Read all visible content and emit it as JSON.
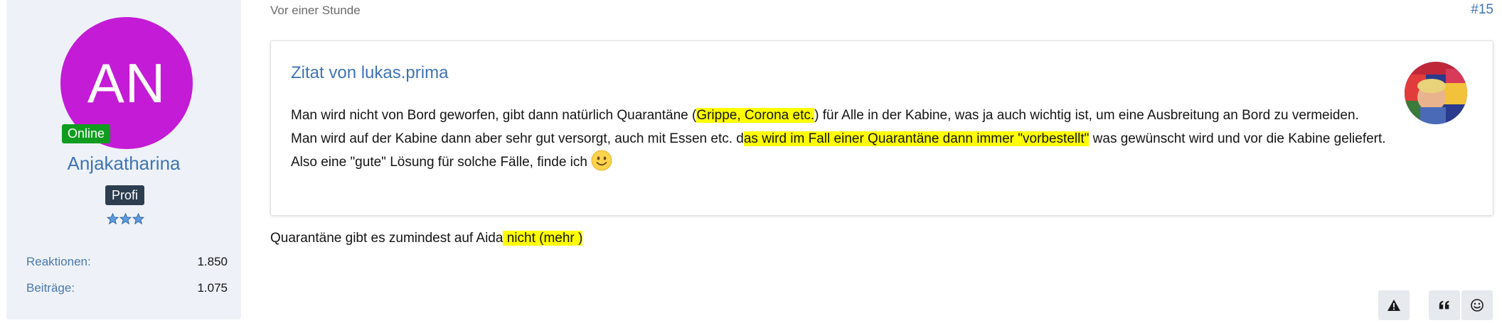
{
  "user": {
    "initials": "AN",
    "avatar_color": "#c41bd6",
    "online_label": "Online",
    "name": "Anjakatharina",
    "role": "Profi",
    "stars": 3,
    "stats": [
      {
        "label": "Reaktionen:",
        "value": "1.850"
      },
      {
        "label": "Beiträge:",
        "value": "1.075"
      }
    ]
  },
  "post": {
    "date": "Vor einer Stunde",
    "number": "#15",
    "body_before": "Quarantäne gibt es zumindest auf Aida",
    "body_highlight": " nicht (mehr )"
  },
  "quote": {
    "title": "Zitat von lukas.prima",
    "line1_a": "Man wird nicht von Bord geworfen, gibt dann natürlich Quarantäne (",
    "line1_hl": "Grippe, Corona etc.",
    "line1_b": ") für Alle in der Kabine, was ja auch wichtig ist, um eine Ausbreitung an Bord zu vermeiden.",
    "line2_a": "Man wird auf der Kabine dann aber sehr gut versorgt, auch mit Essen etc. d",
    "line2_hl": "as wird im Fall einer Quarantäne dann immer \"vorbestellt\"",
    "line2_b": " was gewünscht wird und vor die Kabine geliefert.",
    "line3": "Also eine \"gute\" Lösung für solche Fälle, finde ich"
  },
  "actions": {
    "report_icon": "warning-icon",
    "quote_icon": "quote-icon",
    "react_icon": "smiley-icon"
  },
  "colors": {
    "accent": "#3f74b3",
    "highlight": "#ffff00",
    "online": "#109c1f",
    "role_badge": "#2c3e50",
    "sidebar_bg": "#eef2f8"
  }
}
